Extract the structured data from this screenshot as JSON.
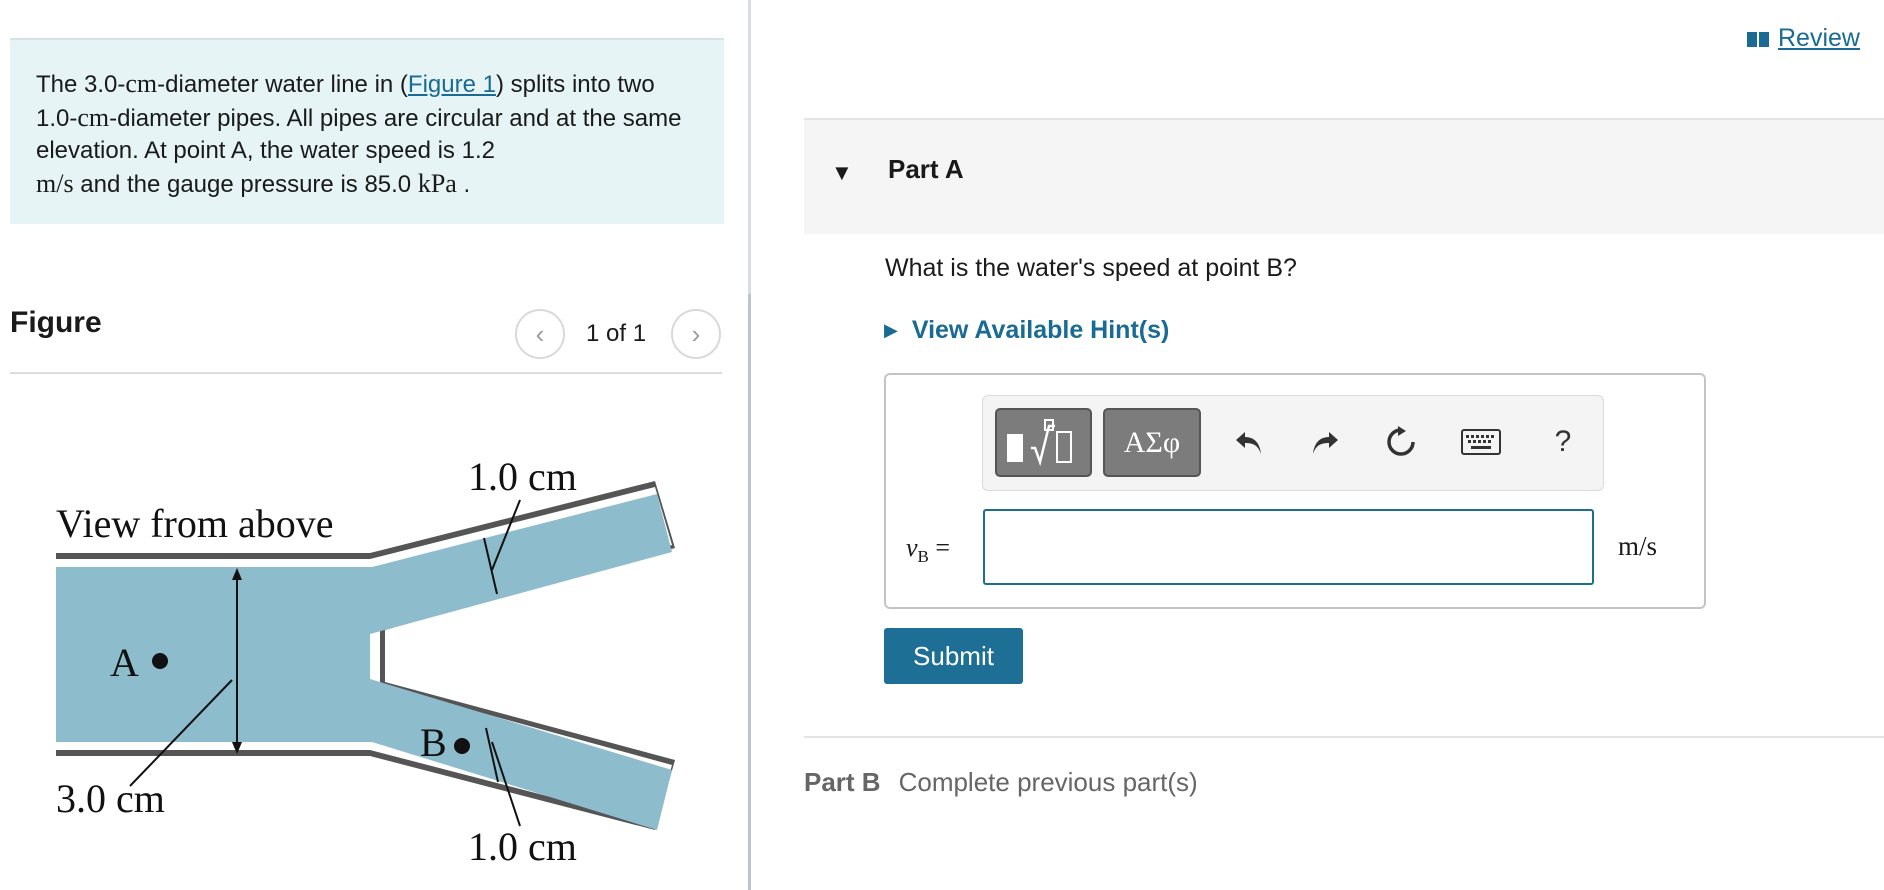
{
  "problem": {
    "t1": "The 3.0-",
    "t2": "cm",
    "t3": "-diameter water line in (",
    "figure_link": "Figure 1",
    "t4": ") splits into two 1.0-",
    "t5": "cm",
    "t6": "-diameter pipes. All pipes are circular and at the same elevation. At point A, the water speed is 1.2",
    "t7": "m/s",
    "t8": " and the gauge pressure is 85.0 ",
    "t9": "kPa",
    "t10": " ."
  },
  "figure": {
    "title": "Figure",
    "pager": "1 of 1",
    "prev_icon": "chevron-left-icon",
    "next_icon": "chevron-right-icon",
    "diagram": {
      "view_label": "View from above",
      "label_a": "A",
      "label_b": "B",
      "dim_main": "3.0 cm",
      "dim_top": "1.0 cm",
      "dim_bottom": "1.0 cm",
      "water_color": "#8dbccc"
    }
  },
  "review": {
    "label": "Review",
    "icon": "book-icon"
  },
  "part_a": {
    "title": "Part A",
    "caret_icon": "caret-down-icon",
    "question": "What is the water's speed at point B?",
    "hint_label": "View Available Hint(s)",
    "hint_icon": "caret-right-icon",
    "toolbar": {
      "templates": "templates-icon",
      "greek": "ΑΣφ",
      "undo": "undo-icon",
      "redo": "redo-icon",
      "reset": "reset-icon",
      "keyboard": "keyboard-icon",
      "help": "?"
    },
    "variable": "v",
    "variable_sub": "B",
    "equals": "=",
    "answer_value": "",
    "units": "m/s",
    "submit_label": "Submit"
  },
  "part_b": {
    "title": "Part B",
    "status": "Complete previous part(s)"
  },
  "colors": {
    "accent": "#1e6f95",
    "link": "#1a6b94",
    "problem_bg": "#e6f4f6"
  }
}
